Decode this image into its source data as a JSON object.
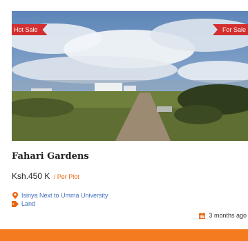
{
  "listing": {
    "ribbon_left": "Hot Sale",
    "ribbon_right": "For Sale",
    "title": "Fahari Gardens",
    "price": "Ksh.450 K",
    "price_unit": "/ Per Plot",
    "location": "Isinya Next to Umma University",
    "category": "Land",
    "posted": "3 months ago"
  },
  "colors": {
    "ribbon": "#d32f2f",
    "accent": "#f47b20",
    "link": "#3f6dbd"
  },
  "icons": {
    "location": "map-marker-icon",
    "category": "tag-icon",
    "date": "calendar-icon"
  }
}
